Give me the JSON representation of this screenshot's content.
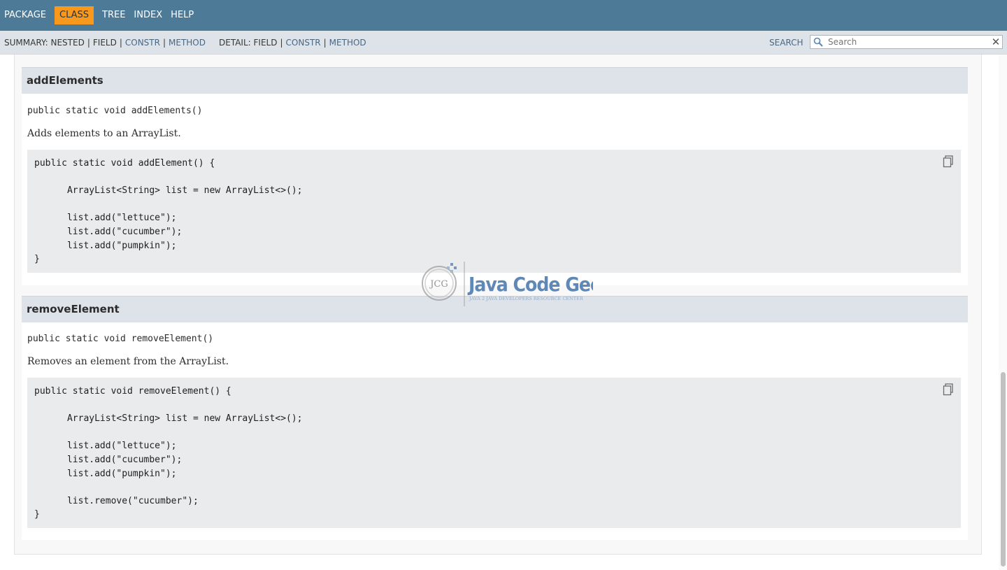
{
  "topnav": {
    "items": [
      {
        "label": "PACKAGE",
        "active": false
      },
      {
        "label": "CLASS",
        "active": true
      },
      {
        "label": "TREE",
        "active": false
      },
      {
        "label": "INDEX",
        "active": false
      },
      {
        "label": "HELP",
        "active": false
      }
    ]
  },
  "subnav": {
    "summary_label": "SUMMARY:",
    "summary_nested": "NESTED",
    "summary_field": "FIELD",
    "summary_constr": "CONSTR",
    "summary_method": "METHOD",
    "detail_label": "DETAIL:",
    "detail_field": "FIELD",
    "detail_constr": "CONSTR",
    "detail_method": "METHOD",
    "separator": "|",
    "search_label": "SEARCH",
    "search_placeholder": "Search"
  },
  "methods": [
    {
      "name": "addElements",
      "signature": "public static void addElements()",
      "description": "Adds elements to an ArrayList.",
      "code": "public static void addElement() {\n\n      ArrayList<String> list = new ArrayList<>();\n\n      list.add(\"lettuce\");\n      list.add(\"cucumber\");\n      list.add(\"pumpkin\");\n}"
    },
    {
      "name": "removeElement",
      "signature": "public static void removeElement()",
      "description": "Removes an element from the ArrayList.",
      "code": "public static void removeElement() {\n\n      ArrayList<String> list = new ArrayList<>();\n\n      list.add(\"lettuce\");\n      list.add(\"cucumber\");\n      list.add(\"pumpkin\");\n\n      list.remove(\"cucumber\");\n}"
    }
  ],
  "watermark": {
    "badge": "JCG",
    "title": "Java Code Geeks",
    "tagline": "JAVA 2 JAVA DEVELOPERS RESOURCE CENTER"
  },
  "colors": {
    "topnav_bg": "#4d7a97",
    "active_tab": "#f8981d",
    "subnav_bg": "#dee3e9",
    "link": "#4a6782",
    "code_bg": "#eaebec"
  }
}
